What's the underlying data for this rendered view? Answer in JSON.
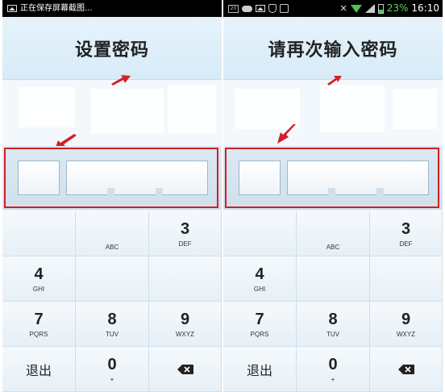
{
  "left": {
    "status": {
      "text": "正在保存屏幕截图..."
    },
    "title": "设置密码"
  },
  "right": {
    "status": {
      "box_icon_text": "20",
      "battery_percent": "23%",
      "time": "16:10"
    },
    "title": "请再次输入密码"
  },
  "keypad": {
    "k3": {
      "digit": "3",
      "letters": "DEF"
    },
    "k2": {
      "letters": "ABC"
    },
    "k4": {
      "digit": "4",
      "letters": "GHI"
    },
    "k7": {
      "digit": "7",
      "letters": "PQRS"
    },
    "k8": {
      "digit": "8",
      "letters": "TUV"
    },
    "k9": {
      "digit": "9",
      "letters": "WXYZ"
    },
    "exit": "退出",
    "k0": {
      "digit": "0",
      "letters": "+"
    }
  },
  "colors": {
    "highlight_frame": "#d21f26",
    "arrow": "#d21f26",
    "battery": "#4cc34c"
  }
}
